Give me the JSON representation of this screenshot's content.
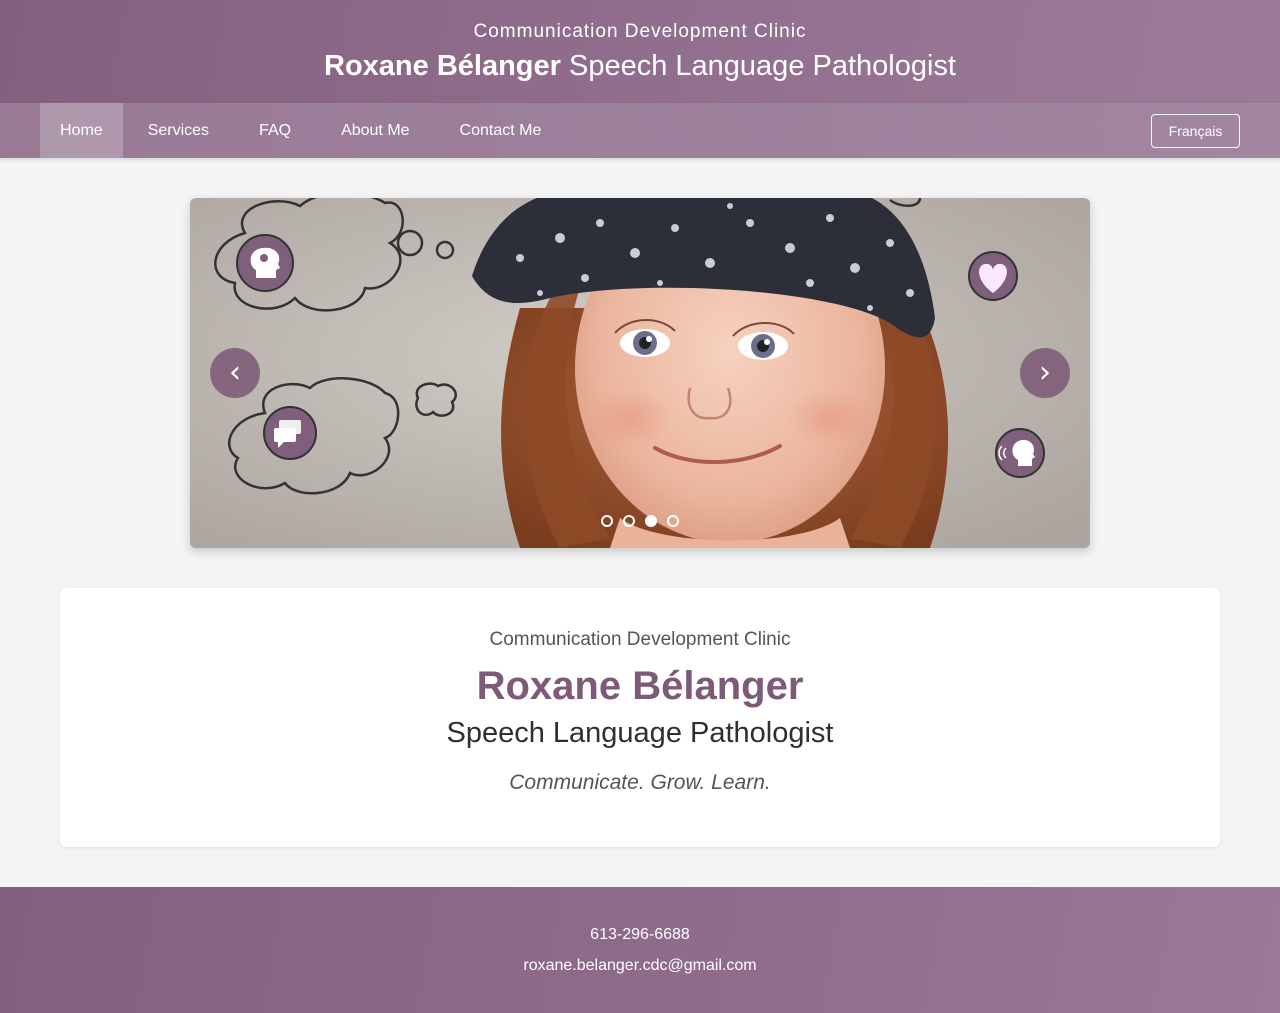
{
  "header": {
    "clinic": "Communication Development Clinic",
    "name": "Roxane Bélanger",
    "title": "Speech Language Pathologist"
  },
  "nav": {
    "items": [
      {
        "label": "Home",
        "active": true
      },
      {
        "label": "Services",
        "active": false
      },
      {
        "label": "FAQ",
        "active": false
      },
      {
        "label": "About Me",
        "active": false
      },
      {
        "label": "Contact Me",
        "active": false
      }
    ],
    "language_button": "Français"
  },
  "carousel": {
    "prev_label": "‹",
    "next_label": "›",
    "slide_count": 4,
    "active_slide": 3,
    "icons": [
      "brain-head-icon",
      "heart-icon",
      "chat-bubbles-icon",
      "speaking-head-icon"
    ]
  },
  "intro": {
    "clinic": "Communication Development Clinic",
    "name": "Roxane Bélanger",
    "role": "Speech Language Pathologist",
    "tagline": "Communicate. Grow. Learn."
  },
  "footer": {
    "phone": "613-296-6688",
    "email": "roxane.belanger.cdc@gmail.com"
  },
  "colors": {
    "brand_purple": "#84607f",
    "accent_name": "#7c5a78",
    "page_background": "#f4f4f4"
  }
}
